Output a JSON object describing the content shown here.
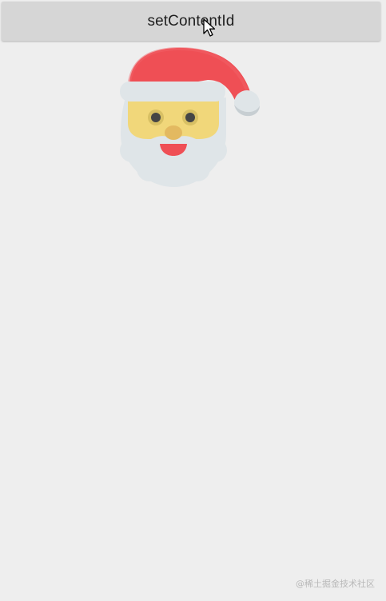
{
  "button": {
    "label": "setContentId"
  },
  "image": {
    "icon": "santa-claus-icon"
  },
  "watermark": {
    "text": "@稀土掘金技术社区"
  }
}
